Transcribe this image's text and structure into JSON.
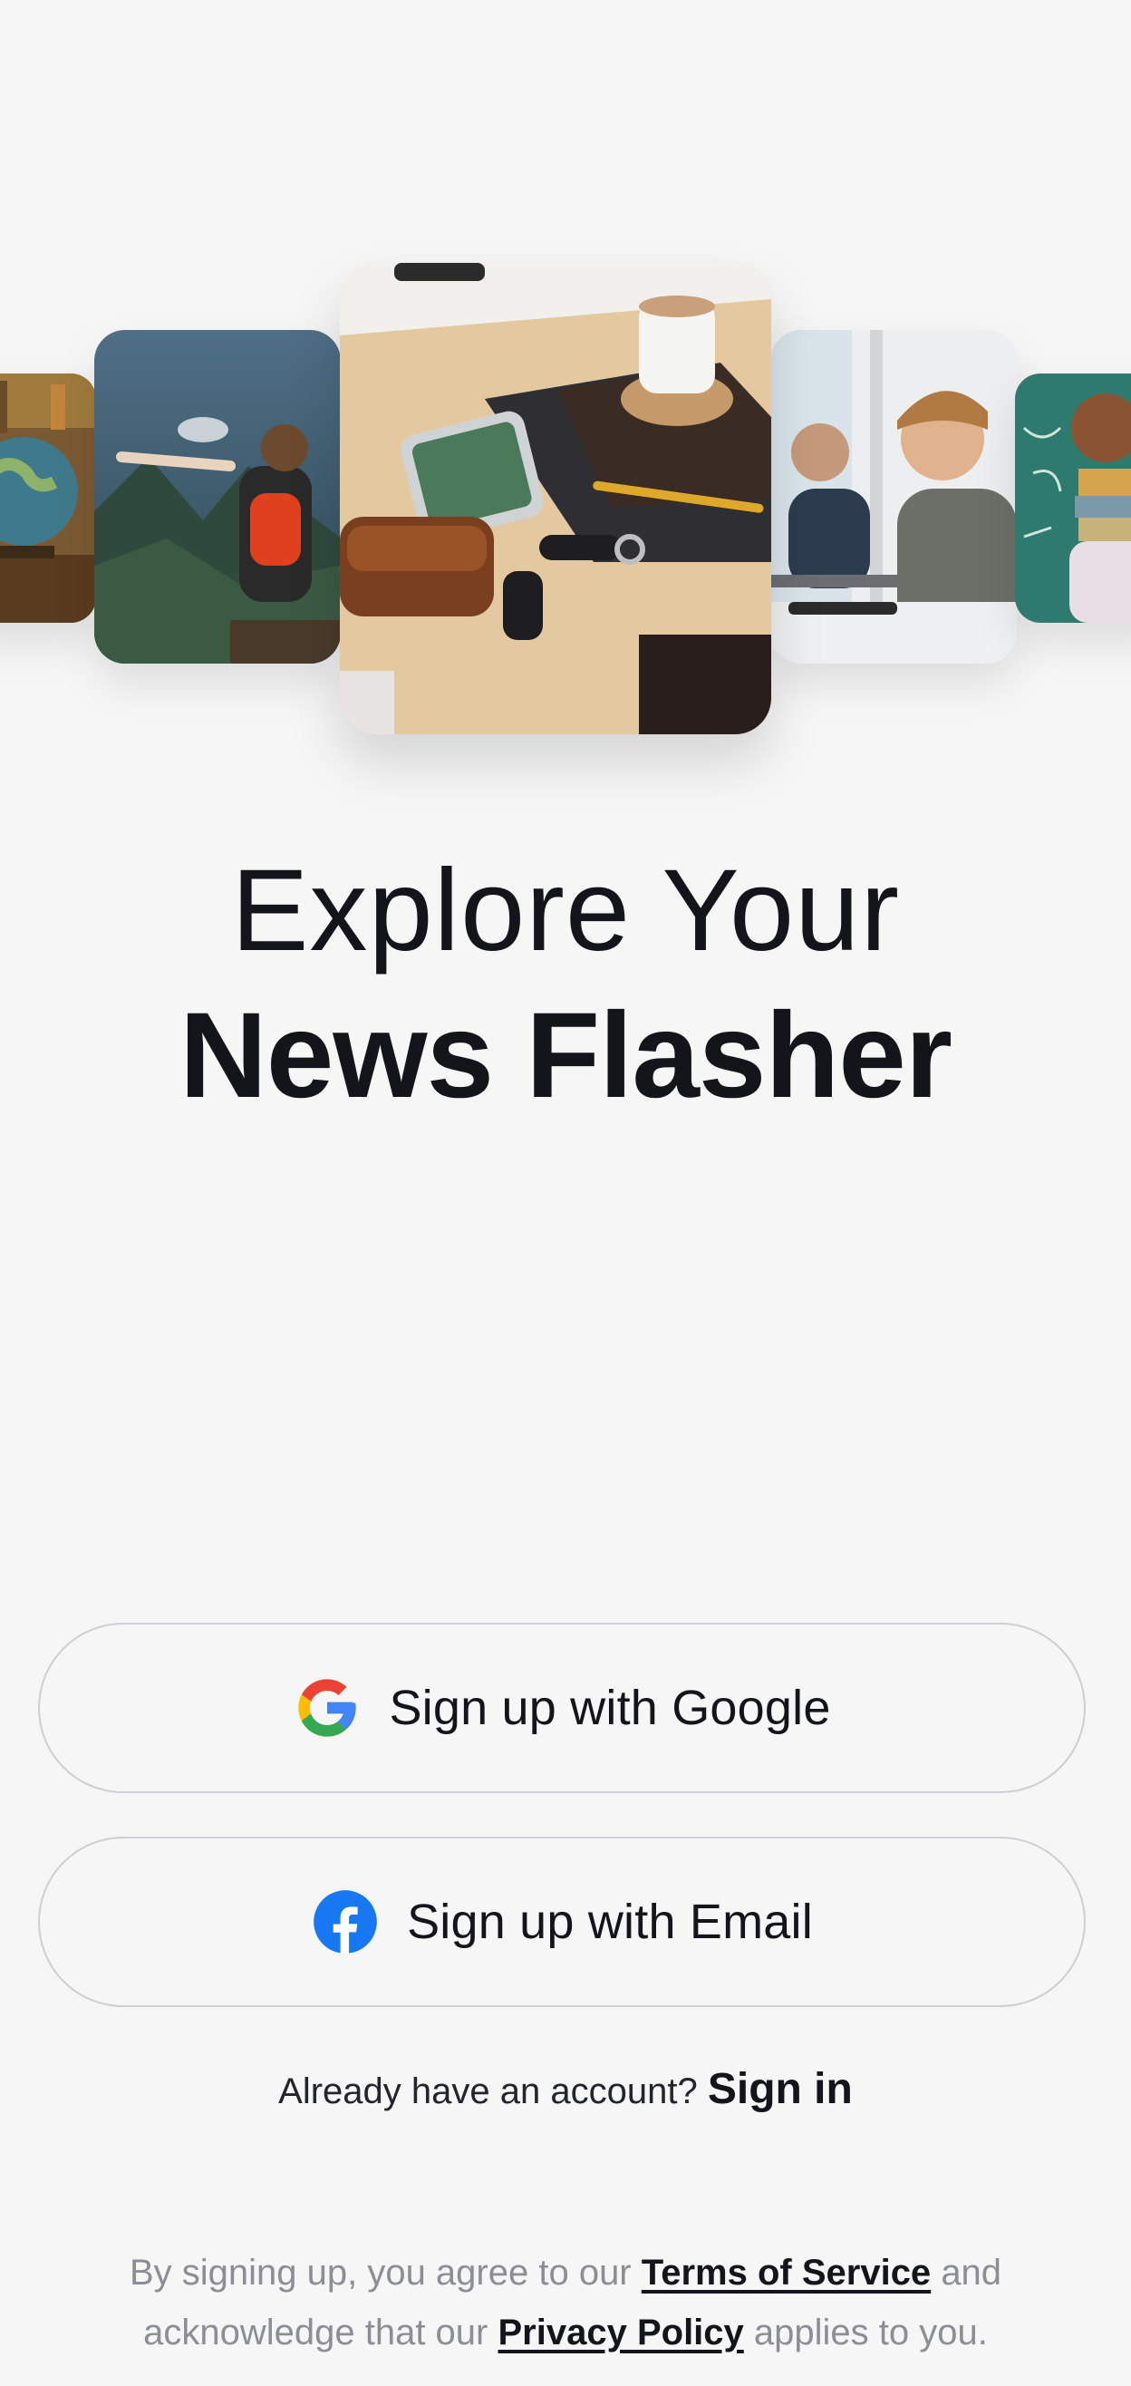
{
  "colors": {
    "background": "#f6f6f7",
    "text_primary": "#14151a",
    "text_muted": "#8d8e94",
    "button_border": "#cfcfd3",
    "google_blue": "#4285F4",
    "google_red": "#EA4335",
    "google_yellow": "#FBBC05",
    "google_green": "#34A853",
    "facebook_blue": "#1877F2"
  },
  "carousel": {
    "images": [
      {
        "name": "library-globe-image"
      },
      {
        "name": "hiker-mountain-image"
      },
      {
        "name": "desk-phone-coffee-image"
      },
      {
        "name": "office-workers-image"
      },
      {
        "name": "student-books-image"
      }
    ]
  },
  "headline": {
    "line1": "Explore Your",
    "line2": "News Flasher"
  },
  "buttons": {
    "google": {
      "label": "Sign up with Google",
      "icon": "google-icon"
    },
    "email": {
      "label": "Sign up with Email",
      "icon": "facebook-icon"
    }
  },
  "signin": {
    "prompt": "Already have an account?",
    "link": "Sign in"
  },
  "legal": {
    "text1": "By signing up, you agree to our",
    "terms": "Terms of Service",
    "text2": "and acknowledge that our",
    "privacy": "Privacy Policy",
    "text3": "applies to you."
  }
}
